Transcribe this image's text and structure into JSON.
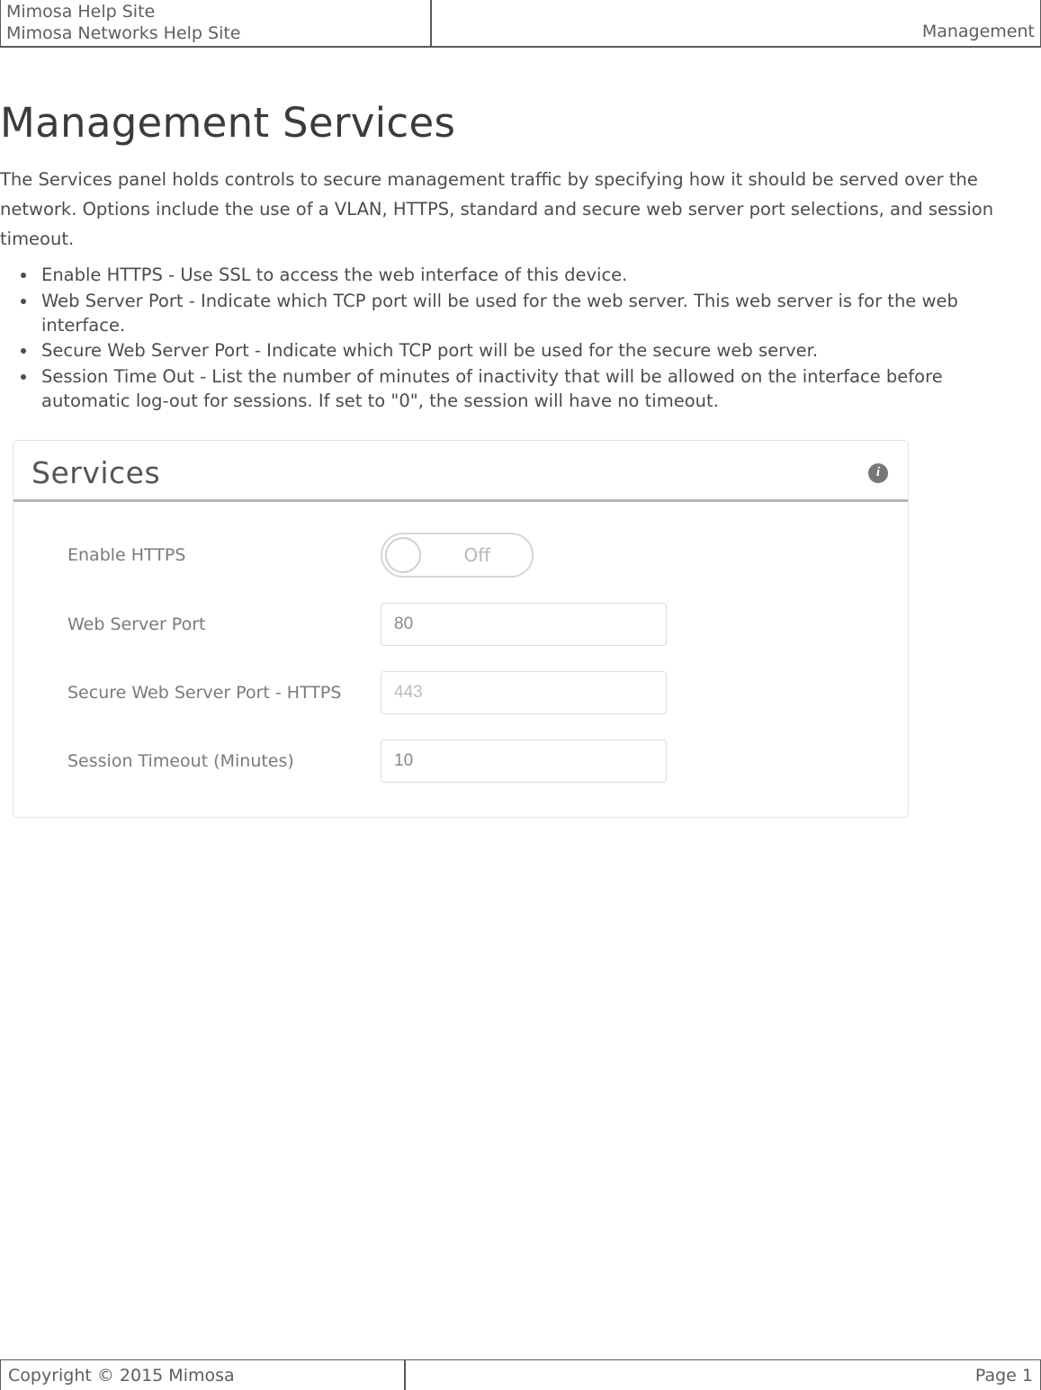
{
  "header": {
    "title_line1": "Mimosa Help Site",
    "title_line2": "Mimosa Networks Help Site",
    "section": "Management"
  },
  "page": {
    "heading": "Management Services",
    "intro": "The Services panel holds controls to secure management traffic by specifying how it should be served over the network. Options include the use of a VLAN, HTTPS, standard and secure web server port selections, and session timeout.",
    "bullets": [
      "Enable HTTPS - Use SSL to access the web interface of this device.",
      "Web Server Port - Indicate which TCP port will be used for the web server. This web server is for the web interface.",
      "Secure Web Server Port - Indicate which TCP port will be used for the secure web server.",
      "Session Time Out - List the number of minutes of inactivity that will be allowed on the interface before automatic log-out for sessions. If set to \"0\", the session will have no timeout."
    ]
  },
  "panel": {
    "title": "Services",
    "info_glyph": "i",
    "rows": {
      "enable_https": {
        "label": "Enable HTTPS",
        "toggle_state": "Off"
      },
      "web_port": {
        "label": "Web Server Port",
        "value": "80"
      },
      "secure_web_port": {
        "label": "Secure Web Server Port - HTTPS",
        "value": "443"
      },
      "session_timeout": {
        "label": "Session Timeout (Minutes)",
        "value": "10"
      }
    }
  },
  "footer": {
    "copyright": "Copyright © 2015 Mimosa",
    "page": "Page 1"
  }
}
